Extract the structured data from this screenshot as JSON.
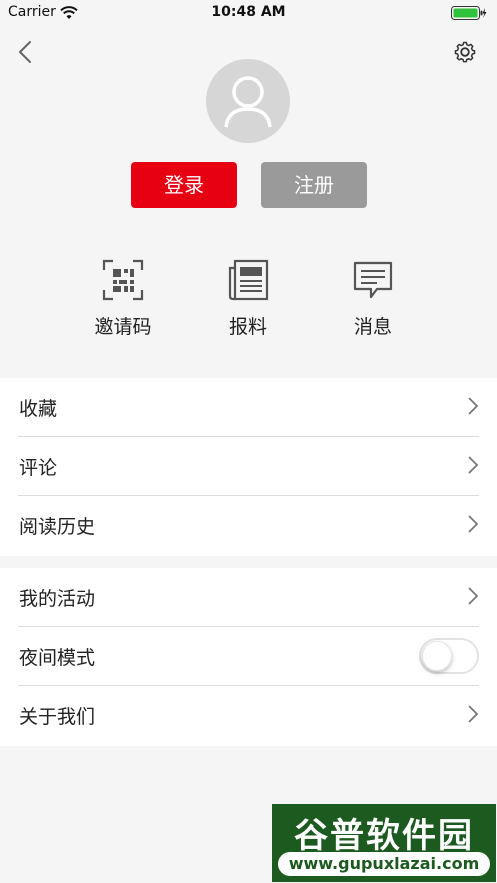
{
  "status_bar": {
    "carrier": "Carrier",
    "time": "10:48 AM"
  },
  "header": {
    "back_icon": "chevron-left-icon",
    "settings_icon": "gear-icon",
    "avatar_icon": "user-avatar-placeholder"
  },
  "auth": {
    "login_label": "登录",
    "register_label": "注册",
    "login_color": "#e60012",
    "register_color": "#9a9a9a"
  },
  "quick_actions": [
    {
      "label": "邀请码",
      "icon": "qr-code-icon"
    },
    {
      "label": "报料",
      "icon": "newspaper-icon"
    },
    {
      "label": "消息",
      "icon": "message-icon"
    }
  ],
  "menu_group_1": [
    {
      "label": "收藏"
    },
    {
      "label": "评论"
    },
    {
      "label": "阅读历史"
    }
  ],
  "menu_group_2": [
    {
      "label": "我的活动"
    },
    {
      "label": "夜间模式",
      "toggle": false
    },
    {
      "label": "关于我们"
    }
  ],
  "watermark": {
    "title": "谷普软件园",
    "url": "www.gupuxlazai.com"
  }
}
